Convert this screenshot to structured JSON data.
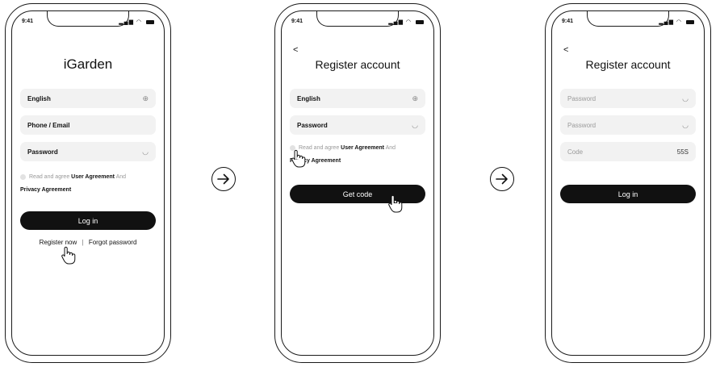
{
  "status_bar": {
    "time": "9:41"
  },
  "screen1": {
    "title": "iGarden",
    "language_value": "English",
    "account_placeholder": "Phone / Email",
    "password_placeholder": "Password",
    "agree_prefix": "Read and agree",
    "user_agreement": "User Agreement",
    "agree_and": "And",
    "privacy_agreement": "Privacy Agreement",
    "login_label": "Log in",
    "register_link": "Register now",
    "separator": "|",
    "forgot_link": "Forgot password"
  },
  "screen2": {
    "back": "<",
    "title": "Register account",
    "language_value": "English",
    "password_placeholder": "Password",
    "agree_prefix": "Read and agree",
    "user_agreement": "User Agreement",
    "agree_and": "And",
    "privacy_agreement": "Privacy Agreement",
    "get_code_label": "Get code"
  },
  "screen3": {
    "back": "<",
    "title": "Register account",
    "password_placeholder": "Password",
    "confirm_password_placeholder": "Password",
    "code_placeholder": "Code",
    "code_timer": "55S",
    "login_label": "Log in"
  },
  "icons": {
    "language": "globe-icon",
    "password_toggle": "eye-closed-icon",
    "flow": "arrow-right-circle-icon",
    "pointer": "hand-pointer-icon"
  }
}
